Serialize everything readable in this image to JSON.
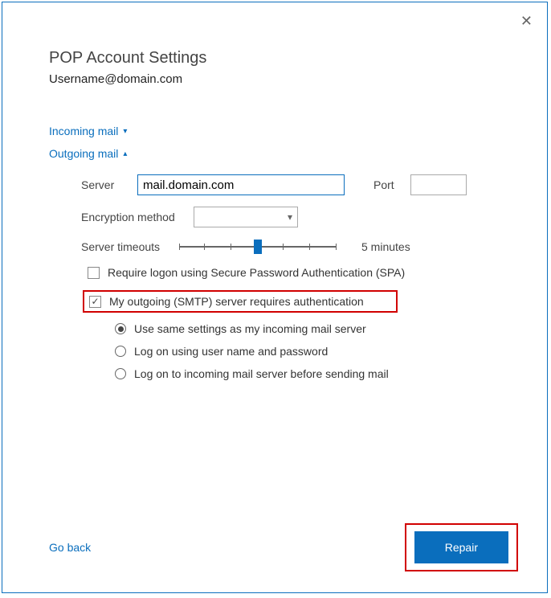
{
  "dialog": {
    "title": "POP Account Settings",
    "subtitle": "Username@domain.com"
  },
  "sections": {
    "incoming": {
      "label": "Incoming mail",
      "expanded": false
    },
    "outgoing": {
      "label": "Outgoing mail",
      "expanded": true
    }
  },
  "outgoing": {
    "server_label": "Server",
    "server_value": "mail.domain.com",
    "port_label": "Port",
    "port_value": "",
    "encryption_label": "Encryption method",
    "encryption_value": "",
    "timeout_label": "Server timeouts",
    "timeout_value": "5 minutes",
    "spa_label": "Require logon using Secure Password Authentication (SPA)",
    "spa_checked": false,
    "smtp_auth_label": "My outgoing (SMTP) server requires authentication",
    "smtp_auth_checked": true,
    "auth_options": {
      "same": {
        "label": "Use same settings as my incoming mail server",
        "selected": true
      },
      "logon": {
        "label": "Log on using user name and password",
        "selected": false
      },
      "incoming_first": {
        "label": "Log on to incoming mail server before sending mail",
        "selected": false
      }
    }
  },
  "footer": {
    "go_back": "Go back",
    "repair": "Repair"
  }
}
